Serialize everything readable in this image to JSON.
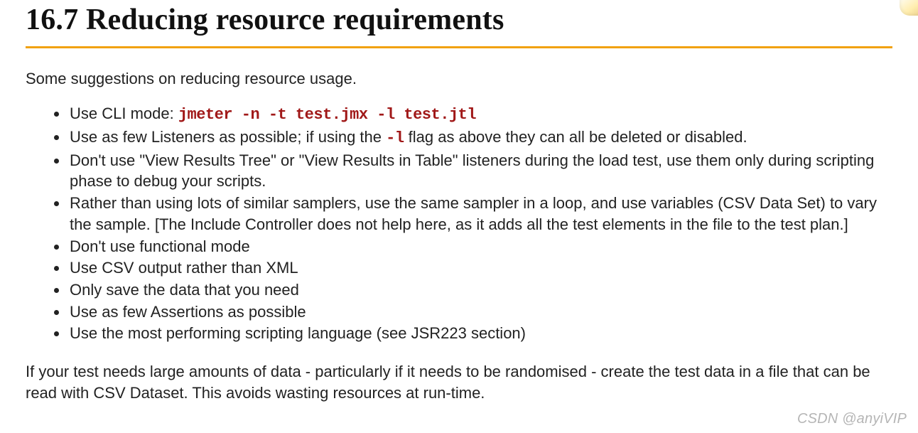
{
  "heading": "16.7 Reducing resource requirements",
  "intro": "Some suggestions on reducing resource usage.",
  "items": {
    "i1_pre": "Use CLI mode: ",
    "i1_code": "jmeter -n -t test.jmx -l test.jtl",
    "i2_pre": "Use as few Listeners as possible; if using the ",
    "i2_code": "-l",
    "i2_post": " flag as above they can all be deleted or disabled.",
    "i3": "Don't use \"View Results Tree\" or \"View Results in Table\" listeners during the load test, use them only during scripting phase to debug your scripts.",
    "i4": "Rather than using lots of similar samplers, use the same sampler in a loop, and use variables (CSV Data Set) to vary the sample. [The Include Controller does not help here, as it adds all the test elements in the file to the test plan.]",
    "i5": "Don't use functional mode",
    "i6": "Use CSV output rather than XML",
    "i7": "Only save the data that you need",
    "i8": "Use as few Assertions as possible",
    "i9": "Use the most performing scripting language (see JSR223 section)"
  },
  "closing": "If your test needs large amounts of data - particularly if it needs to be randomised - create the test data in a file that can be read with CSV Dataset. This avoids wasting resources at run-time.",
  "watermark": "CSDN @anyiVIP"
}
